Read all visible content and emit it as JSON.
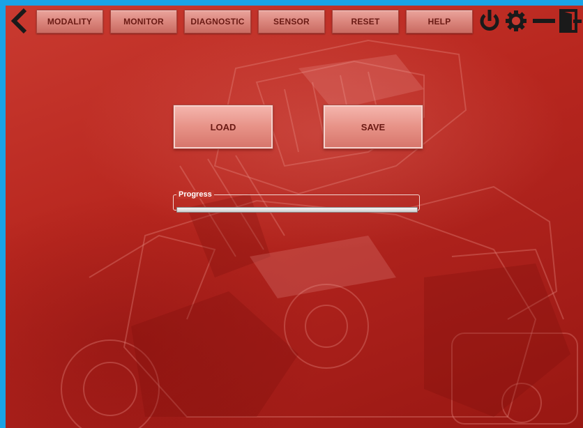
{
  "menu": {
    "items": [
      {
        "id": "modality",
        "label": "MODALITY"
      },
      {
        "id": "monitor",
        "label": "MONITOR"
      },
      {
        "id": "diagnostic",
        "label": "DIAGNOSTIC"
      },
      {
        "id": "sensor",
        "label": "SENSOR"
      },
      {
        "id": "reset",
        "label": "RESET"
      },
      {
        "id": "help",
        "label": "HELP"
      }
    ],
    "icons": [
      "back-arrow-icon",
      "power-icon",
      "gear-icon",
      "minimize-icon",
      "exit-door-icon"
    ]
  },
  "actions": {
    "load_label": "LOAD",
    "save_label": "SAVE"
  },
  "progress": {
    "label": "Progress",
    "value": 0
  },
  "colors": {
    "frame_border": "#1aa3e6",
    "background": "#b8271f",
    "button_face": "#e79287",
    "button_text": "#6a1a14",
    "progress_fill": "#37a42a"
  }
}
